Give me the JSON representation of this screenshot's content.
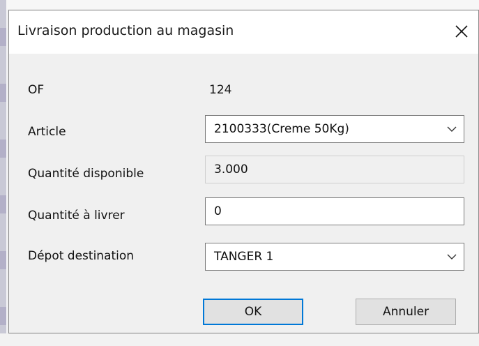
{
  "dialog": {
    "title": "Livraison production au magasin",
    "close_icon": "close-icon"
  },
  "form": {
    "of_label": "OF",
    "of_value": "124",
    "article_label": "Article",
    "article_value": "2100333(Creme 50Kg)",
    "qty_available_label": "Quantité disponible",
    "qty_available_value": "3.000",
    "qty_deliver_label": "Quantité à livrer",
    "qty_deliver_value": "0",
    "depot_label": "Dépot destination",
    "depot_value": "TANGER 1"
  },
  "buttons": {
    "ok_label": "OK",
    "cancel_label": "Annuler"
  },
  "colors": {
    "accent": "#0078d7",
    "dialog_bg": "#f0f0f0",
    "titlebar_bg": "#ffffff"
  }
}
